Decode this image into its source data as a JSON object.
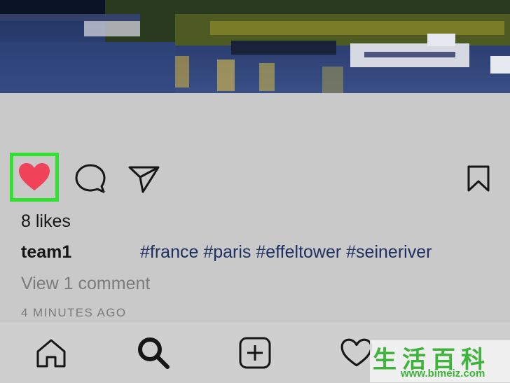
{
  "post": {
    "likes_text": "8 likes",
    "username": "team1",
    "hashtags": "#france #paris #effeltower #seineriver",
    "view_comments": "View 1 comment",
    "timestamp": "4 MINUTES AGO"
  },
  "actions": {
    "like_icon": "heart-filled-icon",
    "comment_icon": "comment-icon",
    "share_icon": "paper-plane-icon",
    "save_icon": "bookmark-icon",
    "like_color": "#f0435a",
    "highlight_color": "#31e031"
  },
  "bottom_nav": {
    "items": [
      {
        "icon": "home-icon"
      },
      {
        "icon": "search-icon"
      },
      {
        "icon": "add-post-icon"
      },
      {
        "icon": "heart-icon"
      }
    ]
  },
  "watermark": {
    "chars": "生活百科",
    "url": "www.bimeiz.com"
  }
}
